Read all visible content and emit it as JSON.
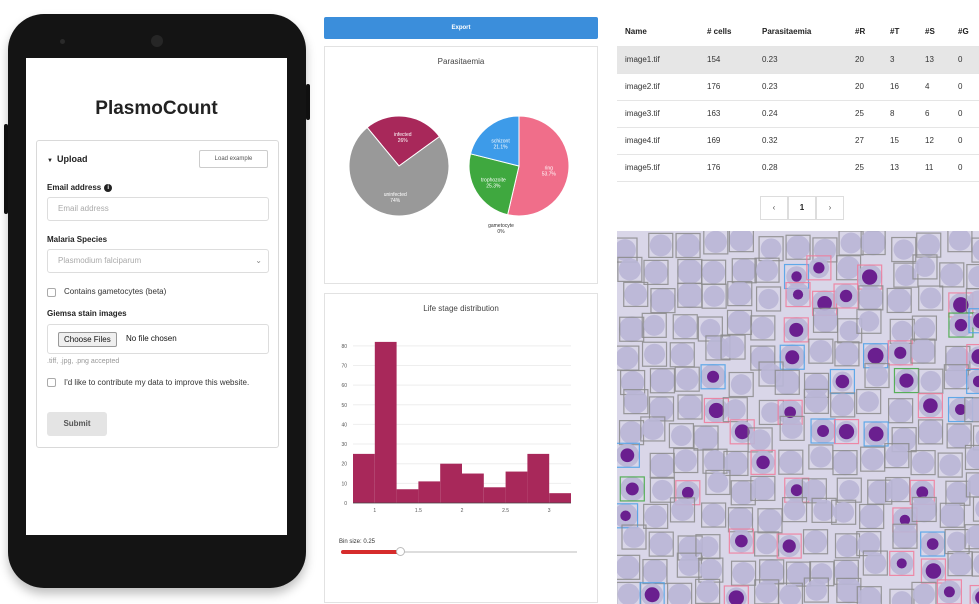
{
  "app": {
    "title": "PlasmoCount"
  },
  "upload": {
    "heading": "Upload",
    "load_example": "Load example",
    "email_label": "Email address",
    "email_placeholder": "Email address",
    "species_label": "Malaria Species",
    "species_value": "Plasmodium falciparum",
    "gametocytes_label": "Contains gametocytes (beta)",
    "images_label": "Giemsa stain images",
    "choose_files": "Choose Files",
    "no_file": "No file chosen",
    "accepted": ".tiff, .jpg, .png accepted",
    "contribute_label": "I'd like to contribute my data to improve this website.",
    "submit": "Submit"
  },
  "export_label": "Export",
  "parasitaemia": {
    "title": "Parasitaemia",
    "chart_data": [
      {
        "type": "pie",
        "labels": [
          "infected",
          "uninfected"
        ],
        "values": [
          26,
          74
        ],
        "display": [
          "26%",
          "74%"
        ],
        "colors": [
          "#a8285a",
          "#999999"
        ]
      },
      {
        "type": "pie",
        "labels": [
          "ring",
          "trophozoite",
          "schizont",
          "gametocyte"
        ],
        "values": [
          53.7,
          25.3,
          21.1,
          0
        ],
        "display": [
          "53.7%",
          "25.3%",
          "21.1%",
          "0%"
        ],
        "colors": [
          "#f06e8a",
          "#3fa83f",
          "#3d9be9",
          "#f0a030"
        ]
      }
    ]
  },
  "life_stage": {
    "title": "Life stage distribution",
    "bin_label": "Bin size: 0.25",
    "chart_data": {
      "type": "bar",
      "title": "Life stage distribution",
      "x_bins": [
        0.75,
        1.0,
        1.25,
        1.5,
        1.75,
        2.0,
        2.25,
        2.5,
        2.75,
        3.0
      ],
      "values": [
        25,
        82,
        7,
        11,
        20,
        15,
        8,
        16,
        25,
        5
      ],
      "xticks": [
        "1",
        "1.5",
        "2",
        "2.5",
        "3"
      ],
      "yticks": [
        "0",
        "10",
        "20",
        "30",
        "40",
        "50",
        "60",
        "70",
        "80"
      ],
      "ylim": [
        0,
        85
      ],
      "xlim": [
        0.75,
        3.25
      ],
      "color": "#a8285a"
    },
    "slider_fraction": 0.25
  },
  "results": {
    "columns": [
      "Name",
      "# cells",
      "Parasitaemia",
      "#R",
      "#T",
      "#S",
      "#G"
    ],
    "rows": [
      [
        "image1.tif",
        "154",
        "0.23",
        "20",
        "3",
        "13",
        "0"
      ],
      [
        "image2.tif",
        "176",
        "0.23",
        "20",
        "16",
        "4",
        "0"
      ],
      [
        "image3.tif",
        "163",
        "0.24",
        "25",
        "8",
        "6",
        "0"
      ],
      [
        "image4.tif",
        "169",
        "0.32",
        "27",
        "15",
        "12",
        "0"
      ],
      [
        "image5.tif",
        "176",
        "0.28",
        "25",
        "13",
        "11",
        "0"
      ]
    ],
    "selected_row": 0
  },
  "pager": {
    "prev": "‹",
    "page": "1",
    "next": "›"
  },
  "icons": {
    "info": "info-icon",
    "caret": "caret-down-icon",
    "select": "chevron-down-icon"
  }
}
